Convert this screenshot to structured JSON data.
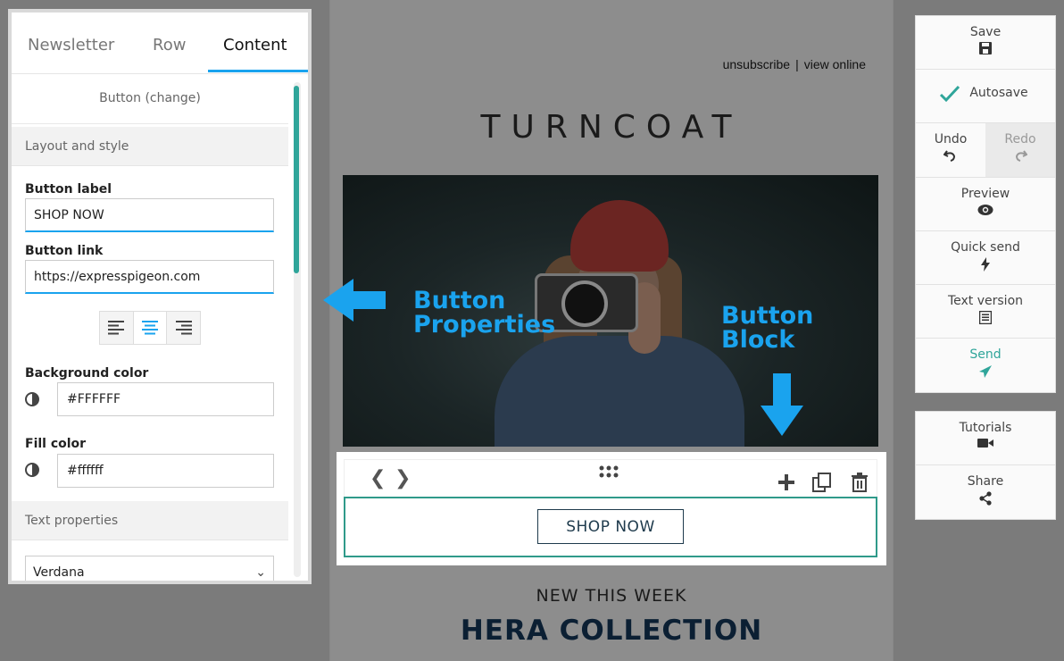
{
  "panel": {
    "tabs": [
      "Newsletter",
      "Row",
      "Content"
    ],
    "block_title": "Button (change)",
    "section_layout": "Layout and style",
    "button_label_title": "Button label",
    "button_label_value": "SHOP NOW",
    "button_link_title": "Button link",
    "button_link_value": "https://expresspigeon.com",
    "background_color_title": "Background color",
    "background_color_value": "#FFFFFF",
    "fill_color_title": "Fill color",
    "fill_color_value": "#ffffff",
    "section_text": "Text properties",
    "font_value": "Verdana"
  },
  "email": {
    "unsubscribe": "unsubscribe",
    "separator": "|",
    "view_online": "view online",
    "brand": "TURNCOAT",
    "annotation_properties_1": "Button",
    "annotation_properties_2": "Properties",
    "annotation_block_1": "Button",
    "annotation_block_2": "Block",
    "button_text": "SHOP NOW",
    "subtitle": "NEW THIS WEEK",
    "title": "HERA COLLECTION"
  },
  "right_panel": {
    "save": "Save",
    "autosave": "Autosave",
    "undo": "Undo",
    "redo": "Redo",
    "preview": "Preview",
    "quick_send": "Quick send",
    "text_version": "Text version",
    "send": "Send",
    "tutorials": "Tutorials",
    "share": "Share"
  },
  "colors": {
    "accent": "#1aa3ee",
    "teal": "#2fa59a",
    "title_navy": "#0b1f33"
  }
}
